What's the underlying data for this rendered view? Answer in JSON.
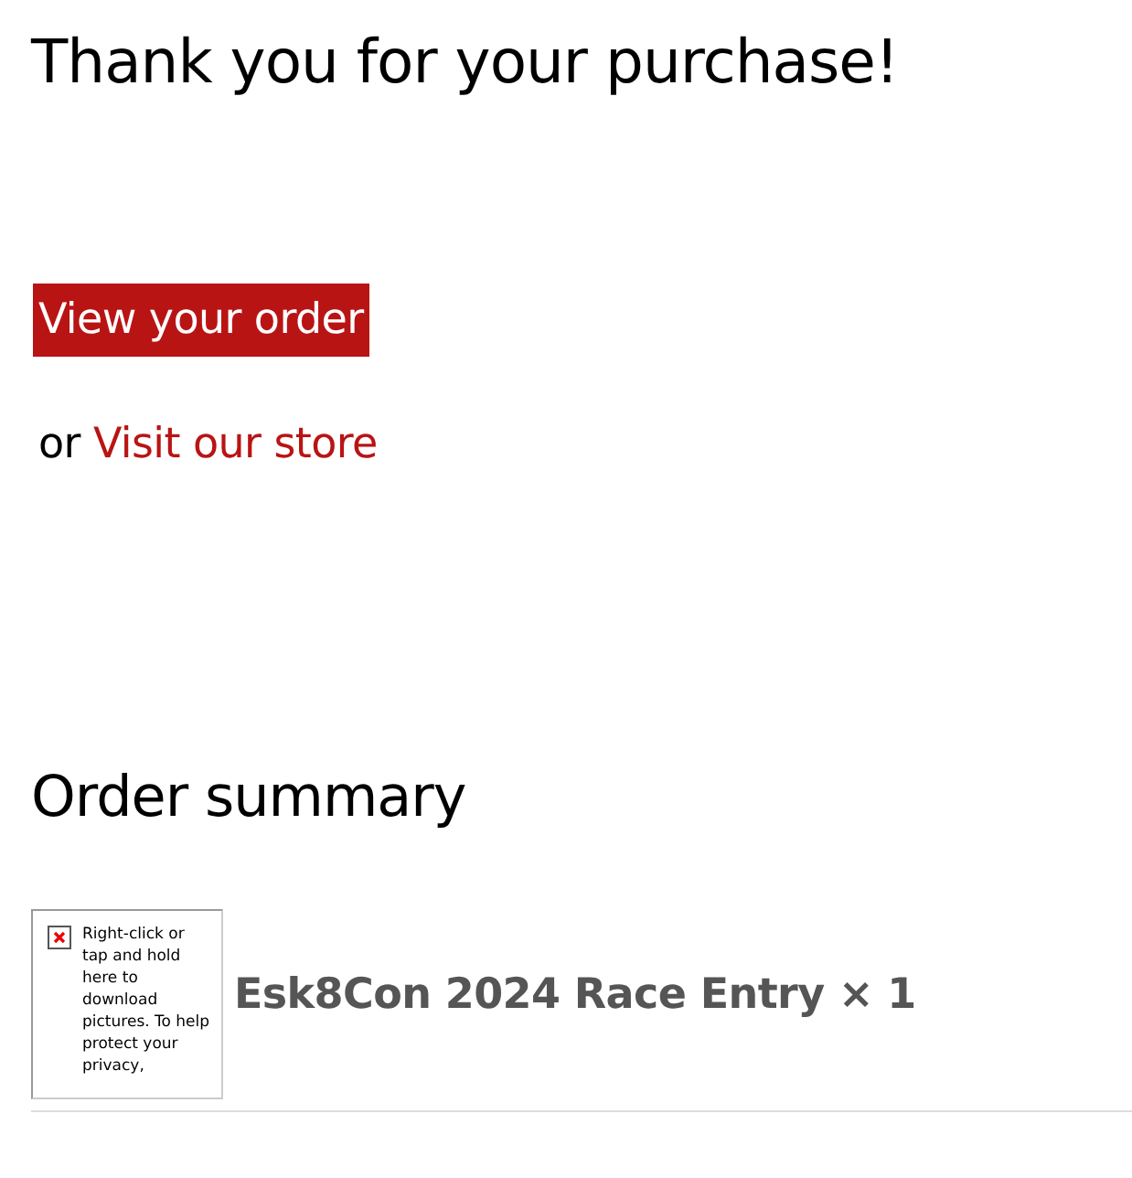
{
  "heading": "Thank you for your purchase!",
  "order_button": "View your order",
  "store_line": {
    "prefix": "or",
    "link": "Visit our store"
  },
  "summary_heading": "Order summary",
  "items": [
    {
      "image_notice": "Right-click or tap and hold here to download pictures. To help protect your privacy,",
      "title": "Esk8Con 2024 Race Entry × 1"
    }
  ]
}
